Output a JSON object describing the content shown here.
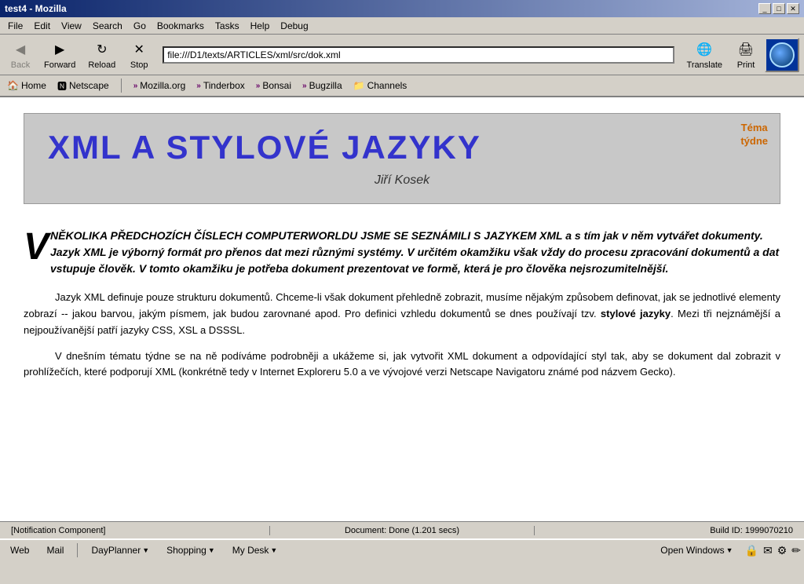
{
  "titlebar": {
    "title": "test4 - Mozilla",
    "buttons": [
      "_",
      "□",
      "✕"
    ]
  },
  "menubar": {
    "items": [
      "File",
      "Edit",
      "View",
      "Search",
      "Go",
      "Bookmarks",
      "Tasks",
      "Help",
      "Debug"
    ]
  },
  "toolbar": {
    "back_label": "Back",
    "forward_label": "Forward",
    "reload_label": "Reload",
    "stop_label": "Stop",
    "translate_label": "Translate",
    "print_label": "Print",
    "url": "file:///D1/texts/ARTICLES/xml/src/dok.xml"
  },
  "bookmarks": {
    "home_label": "Home",
    "netscape_label": "Netscape",
    "mozilla_label": "Mozilla.org",
    "tinderbox_label": "Tinderbox",
    "bonsai_label": "Bonsai",
    "bugzilla_label": "Bugzilla",
    "channels_label": "Channels"
  },
  "article": {
    "title": "XML A STYLOVÉ JAZYKY",
    "author": "Jiří Kosek",
    "tema_line1": "Téma",
    "tema_line2": "týdne",
    "lead_dropcap": "V",
    "lead_text": "NĚKOLIKA PŘEDCHOZÍCH ČÍSLECH COMPUTERWORLDU JSME SE SEZNÁMILI S JAZYKEM XML a s tím jak v něm vytvářet dokumenty. Jazyk XML je výborný formát pro přenos dat mezi různými systémy. V určitém okamžiku však vždy do procesu zpracování dokumentů a dat vstupuje člověk. V tomto okamžiku je potřeba dokument prezentovat ve formě, která je pro člověka nejsrozumitelnější.",
    "para1": "Jazyk XML definuje pouze strukturu dokumentů. Chceme-li však dokument přehledně zobrazit, musíme nějakým způsobem definovat, jak se jednotlivé elementy zobrazí -- jakou barvou, jakým písmem, jak budou zarovnané apod. Pro definici vzhledu dokumentů se dnes používají tzv. stylové jazyky. Mezi tři nejznámější a nejpoužívanější patří jazyky CSS, XSL a DSSSL.",
    "para2": "V dnešním tématu týdne se na ně podíváme podrobněji a ukážeme si, jak vytvořit XML dokument a odpovídající styl tak, aby se dokument dal zobrazit v prohlížečích, které podporují XML (konkrétně tedy v Internet Exploreru 5.0 a ve vývojové verzi Netscape Navigatoru známé pod názvem Gecko).",
    "bold_phrase": "stylové jazyky"
  },
  "statusbar": {
    "notification": "[Notification Component]",
    "document_status": "Document: Done (1.201 secs)",
    "build_id": "Build ID: 1999070210"
  },
  "taskbar": {
    "web_label": "Web",
    "mail_label": "Mail",
    "dayplanner_label": "DayPlanner",
    "shopping_label": "Shopping",
    "mydesk_label": "My Desk",
    "openwindows_label": "Open Windows"
  }
}
